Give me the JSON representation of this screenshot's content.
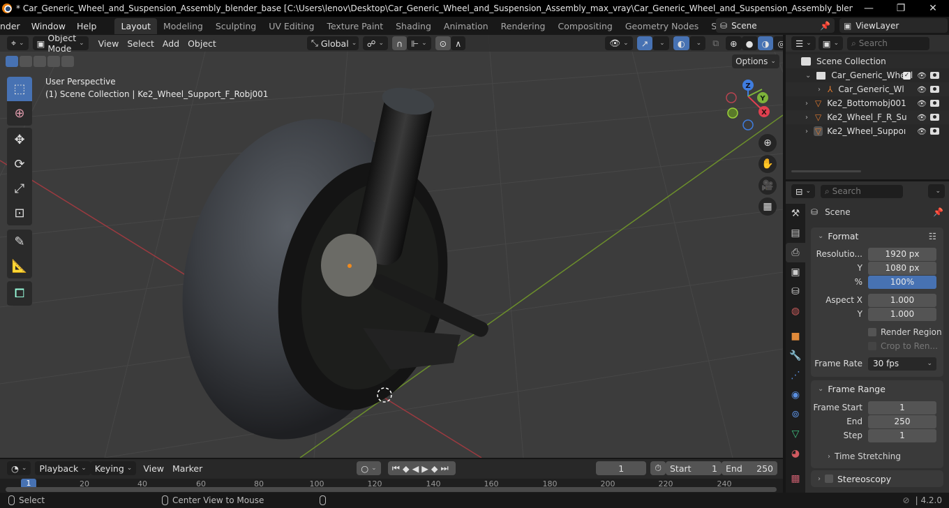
{
  "window": {
    "title": "* Car_Generic_Wheel_and_Suspension_Assembly_blender_base [C:\\Users\\lenov\\Desktop\\Car_Generic_Wheel_and_Suspension_Assembly_max_vray\\Car_Generic_Wheel_and_Suspension_Assembly_blender_base.blend] - Blender ...",
    "minimize": "—",
    "maximize": "❐",
    "close": "✕"
  },
  "menu": {
    "items": [
      "nder",
      "Window",
      "Help"
    ],
    "workspaces": [
      "Layout",
      "Modeling",
      "Sculpting",
      "UV Editing",
      "Texture Paint",
      "Shading",
      "Animation",
      "Rendering",
      "Compositing",
      "Geometry Nodes",
      "Scripting"
    ],
    "active_workspace": "Layout",
    "add_workspace": "+",
    "scene": "Scene",
    "view_layer": "ViewLayer"
  },
  "viewport": {
    "mode": "Object Mode",
    "menus": [
      "View",
      "Select",
      "Add",
      "Object"
    ],
    "orientation": "Global",
    "options": "Options",
    "view_name": "User Perspective",
    "context": "(1) Scene Collection | Ke2_Wheel_Support_F_Robj001",
    "gizmo_axes": [
      "X",
      "Y",
      "Z"
    ]
  },
  "outliner": {
    "search_placeholder": "Search",
    "root": "Scene Collection",
    "rows": [
      {
        "label": "Car_Generic_Wheel",
        "type": "collection",
        "checked": true
      },
      {
        "label": "Car_Generic_Wl",
        "type": "empty"
      },
      {
        "label": "Ke2_Bottomobj001",
        "type": "mesh"
      },
      {
        "label": "Ke2_Wheel_F_R_Su",
        "type": "mesh"
      },
      {
        "label": "Ke2_Wheel_Suppoı",
        "type": "mesh",
        "active": true
      }
    ]
  },
  "properties": {
    "search_placeholder": "Search",
    "context": "Scene",
    "format": {
      "title": "Format",
      "resolution_label": "Resolutio...",
      "resolution_x": "1920 px",
      "y_label": "Y",
      "resolution_y": "1080 px",
      "percent_label": "%",
      "percent": "100%",
      "aspect_x_label": "Aspect X",
      "aspect_x": "1.000",
      "aspect_y": "1.000",
      "render_region": "Render Region",
      "crop": "Crop to Ren...",
      "frame_rate_label": "Frame Rate",
      "frame_rate": "30 fps"
    },
    "frame_range": {
      "title": "Frame Range",
      "start_label": "Frame Start",
      "start": "1",
      "end_label": "End",
      "end": "250",
      "step_label": "Step",
      "step": "1",
      "time_stretching": "Time Stretching"
    },
    "stereoscopy": "Stereoscopy"
  },
  "timeline": {
    "menus": [
      "Playback",
      "Keying",
      "View",
      "Marker"
    ],
    "current_frame": "1",
    "start_label": "Start",
    "start": "1",
    "end_label": "End",
    "end": "250",
    "ticks": [
      "20",
      "40",
      "60",
      "80",
      "100",
      "120",
      "140",
      "160",
      "180",
      "200",
      "220",
      "240"
    ],
    "playhead": "1"
  },
  "status": {
    "select": "Select",
    "center_view": "Center View to Mouse",
    "version": "4.2.0"
  }
}
